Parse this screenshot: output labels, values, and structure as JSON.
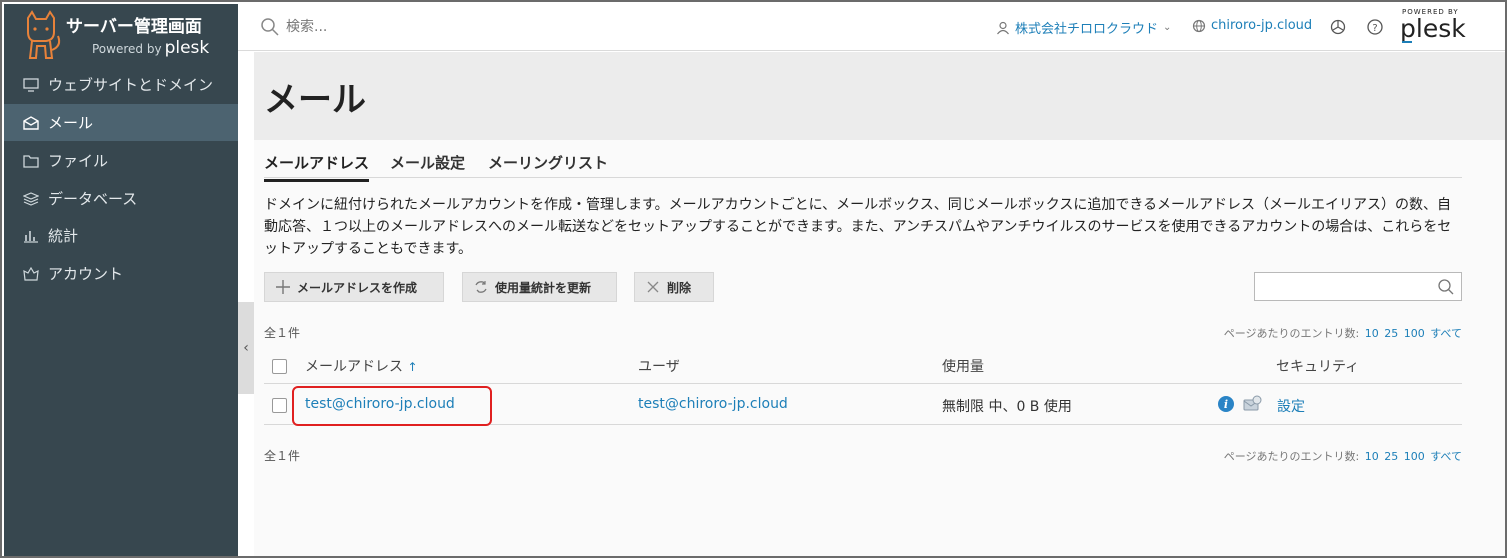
{
  "app": {
    "title": "サーバー管理画面",
    "powered_by": "Powered by",
    "powered_by_brand": "plesk"
  },
  "sidebar": {
    "items": [
      {
        "label": "ウェブサイトとドメイン",
        "icon": "monitor-icon",
        "active": false
      },
      {
        "label": "メール",
        "icon": "envelope-icon",
        "active": true
      },
      {
        "label": "ファイル",
        "icon": "folder-icon",
        "active": false
      },
      {
        "label": "データベース",
        "icon": "database-icon",
        "active": false
      },
      {
        "label": "統計",
        "icon": "bar-chart-icon",
        "active": false
      },
      {
        "label": "アカウント",
        "icon": "account-icon",
        "active": false
      }
    ]
  },
  "topbar": {
    "search_placeholder": "検索...",
    "user": "株式会社チロロクラウド",
    "domain": "chiroro-jp.cloud",
    "logo_small": "POWERED BY",
    "logo_big": "plesk"
  },
  "page": {
    "title": "メール",
    "tabs": [
      "メールアドレス",
      "メール設定",
      "メーリングリスト"
    ],
    "description": "ドメインに紐付けられたメールアカウントを作成・管理します。メールアカウントごとに、メールボックス、同じメールボックスに追加できるメールアドレス（メールエイリアス）の数、自動応答、１つ以上のメールアドレスへのメール転送などをセットアップすることができます。また、アンチスパムやアンチウイルスのサービスを使用できるアカウントの場合は、これらをセットアップすることもできます。"
  },
  "toolbar": {
    "create_label": "メールアドレスを作成",
    "update_stats_label": "使用量統計を更新",
    "delete_label": "削除",
    "search_value": ""
  },
  "list": {
    "count_text": "全１件",
    "per_page_label": "ページあたりのエントリ数:",
    "per_page_options": [
      "10",
      "25",
      "100",
      "すべて"
    ],
    "columns": {
      "address": "メールアドレス",
      "sort_arrow": "↑",
      "user": "ユーザ",
      "usage": "使用量",
      "security": "セキュリティ"
    },
    "rows": [
      {
        "address": "test@chiroro-jp.cloud",
        "user": "test@chiroro-jp.cloud",
        "usage": "無制限 中、0 B 使用",
        "info_glyph": "i",
        "security_link": "設定"
      }
    ]
  },
  "colors": {
    "sidebar_bg": "#37474f",
    "sidebar_active": "#4c6370",
    "link": "#1d7fb8",
    "highlight": "#e02020"
  }
}
